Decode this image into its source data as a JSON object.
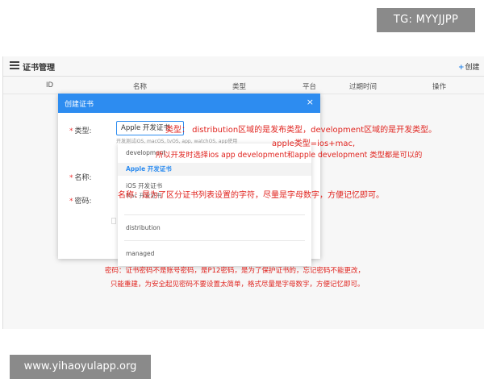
{
  "watermarks": {
    "top": "TG: MYYJJPP",
    "bottom": "www.yihaoyulapp.org"
  },
  "page": {
    "title": "证书管理",
    "create_label": "创建",
    "columns": [
      "ID",
      "名称",
      "类型",
      "平台",
      "过期时间",
      "操作"
    ]
  },
  "modal": {
    "title": "创建证书",
    "close": "×",
    "fields": {
      "type_label": "类型:",
      "name_label": "名称:",
      "password_label": "密码:"
    },
    "type_value": "Apple 开发证书",
    "hint": "开发测试iOS, macOS, tvOS, app, watchOS, app使用"
  },
  "dropdown": {
    "items": [
      {
        "label": "development",
        "selected": false
      },
      {
        "label": "Apple 开发证书",
        "selected": true
      },
      {
        "label": "iOS 开发证书",
        "sub": "Mac 开发证书",
        "selected": false
      },
      {
        "label": "distribution",
        "selected": false
      },
      {
        "label": "managed",
        "selected": false
      }
    ]
  },
  "annotations": {
    "type_note": "类型：  distribution区域的是发布类型，development区域的是开发类型。",
    "apple_note": "apple类型=ios+mac,",
    "choice_note": "所以开发时选择ios app development和apple development 类型都是可以的",
    "name_note": "名称：是为了区分证书列表设置的字符，尽量是字母数字，方便记忆即可。",
    "password_note_1": "密码：证书密码不是账号密码，是P12密码，是为了保护证书的，忘记密码不能更改，",
    "password_note_2": "只能重建，为安全起见密码不要设置太简单，格式尽量是字母数字，方便记忆即可。",
    "color": "#e0241f"
  },
  "colors": {
    "primary": "#2d8cf0",
    "watermark_bg": "#8a8a8a"
  }
}
